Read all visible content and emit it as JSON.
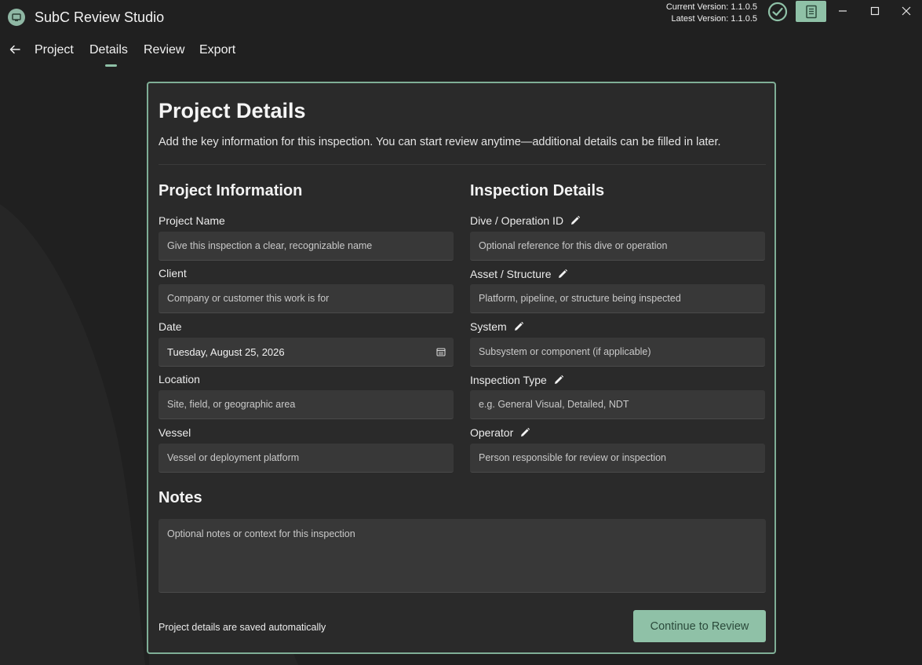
{
  "app": {
    "title": "SubC Review Studio"
  },
  "versions": {
    "current": "Current Version: 1.1.0.5",
    "latest": "Latest Version: 1.1.0.5"
  },
  "nav": {
    "items": [
      "Project",
      "Details",
      "Review",
      "Export"
    ],
    "active": "Details"
  },
  "card": {
    "title": "Project Details",
    "subtitle": "Add the key information for this inspection. You can start review anytime—additional details can be filled in later.",
    "project_info": {
      "heading": "Project Information",
      "fields": [
        {
          "label": "Project Name",
          "placeholder": "Give this inspection a clear, recognizable name"
        },
        {
          "label": "Client",
          "placeholder": "Company or customer this work is for"
        },
        {
          "label": "Date",
          "value": "Tuesday, August 25, 2026"
        },
        {
          "label": "Location",
          "placeholder": "Site, field, or geographic area"
        },
        {
          "label": "Vessel",
          "placeholder": "Vessel or deployment platform"
        }
      ]
    },
    "inspection_details": {
      "heading": "Inspection Details",
      "fields": [
        {
          "label": "Dive / Operation ID",
          "placeholder": "Optional reference for this dive or operation"
        },
        {
          "label": "Asset / Structure",
          "placeholder": "Platform, pipeline, or structure being inspected"
        },
        {
          "label": "System",
          "placeholder": "Subsystem or component (if applicable)"
        },
        {
          "label": "Inspection Type",
          "placeholder": "e.g. General Visual, Detailed, NDT"
        },
        {
          "label": "Operator",
          "placeholder": "Person responsible for review or inspection"
        }
      ]
    },
    "notes": {
      "heading": "Notes",
      "placeholder": "Optional notes or context for this inspection"
    },
    "autosave_text": "Project details are saved automatically",
    "continue_label": "Continue to Review"
  },
  "colors": {
    "accent": "#8fc1a7",
    "card_border": "#7fae96",
    "background": "#202020",
    "card": "#2a2a2a",
    "field": "#383838"
  },
  "icons": [
    "app-logo-icon",
    "check-circle-icon",
    "book-icon",
    "minimize-icon",
    "maximize-icon",
    "close-icon",
    "back-arrow-icon",
    "pencil-icon",
    "calendar-icon"
  ]
}
